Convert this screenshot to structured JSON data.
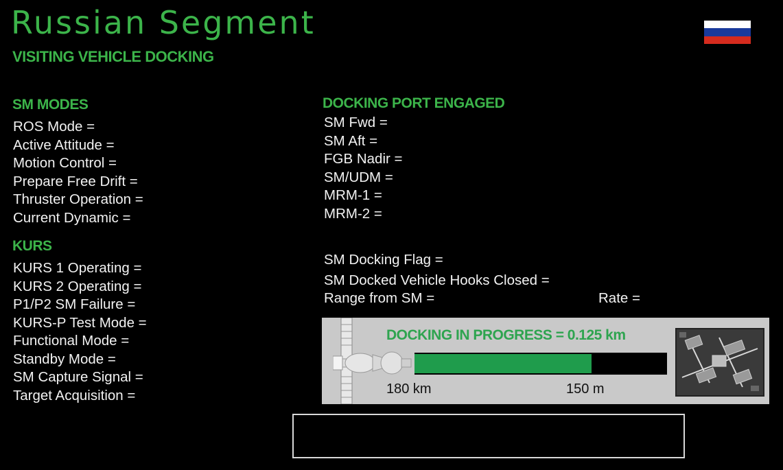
{
  "header": {
    "title": "Russian Segment",
    "subtitle": "VISITING VEHICLE DOCKING",
    "flag_colors": [
      "#ffffff",
      "#1a3a9c",
      "#d52b1e"
    ]
  },
  "sm_modes": {
    "heading": "SM MODES",
    "items": [
      "ROS Mode =",
      "Active Attitude =",
      "Motion Control =",
      "Prepare Free Drift =",
      "Thruster Operation =",
      "Current Dynamic ="
    ]
  },
  "kurs": {
    "heading": "KURS",
    "items": [
      "KURS 1 Operating =",
      "KURS 2 Operating =",
      "P1/P2 SM Failure =",
      "KURS-P Test Mode =",
      "Functional Mode =",
      "Standby Mode =",
      "SM Capture Signal =",
      "Target Acquisition ="
    ]
  },
  "docking_port": {
    "heading": "DOCKING PORT ENGAGED",
    "items": [
      "SM Fwd =",
      "SM Aft =",
      "FGB Nadir =",
      "SM/UDM =",
      "MRM-1 =",
      "MRM-2 ="
    ]
  },
  "docking_status": {
    "flag": "SM Docking Flag =",
    "hooks": "SM Docked Vehicle Hooks Closed =",
    "range": "Range from SM =",
    "rate": "Rate ="
  },
  "progress": {
    "label": "DOCKING IN PROGRESS = 0.125 km",
    "start_label": "180 km",
    "end_label": "150 m",
    "fraction": 0.7,
    "accent": "#1f9c4c"
  },
  "icons": {
    "vehicle": "soyuz-vehicle-icon",
    "station": "iss-thumbnail-icon"
  },
  "message_box": {
    "text": ""
  }
}
